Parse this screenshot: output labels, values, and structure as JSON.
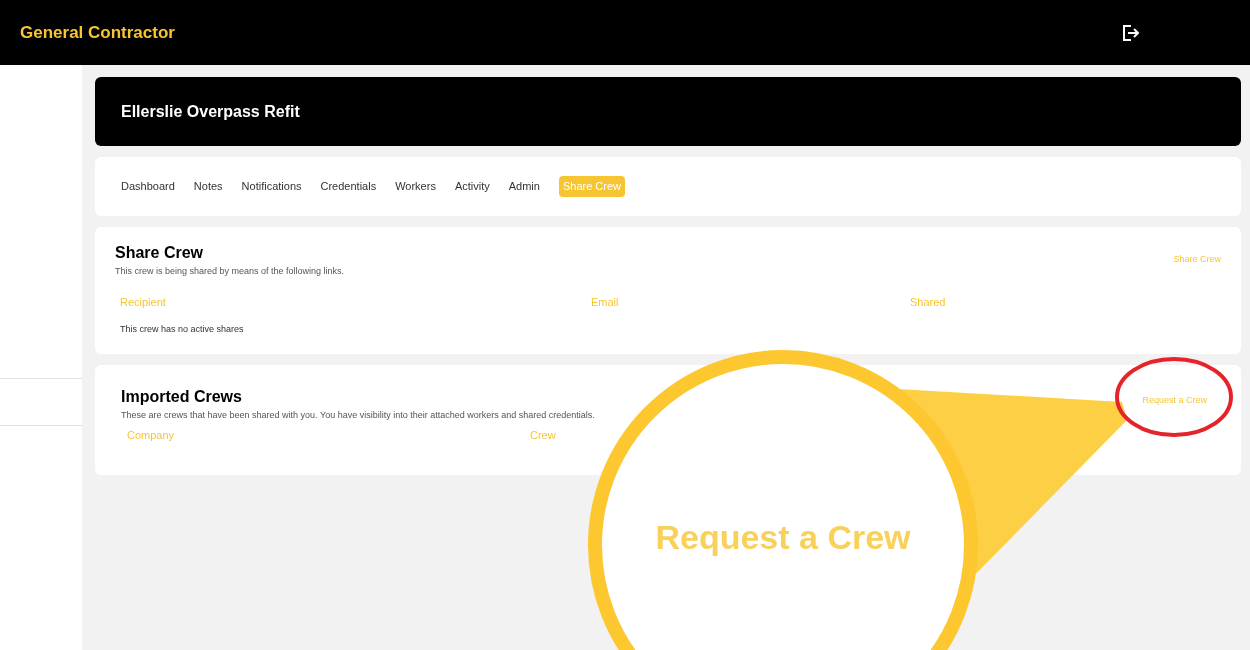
{
  "header": {
    "title": "General Contractor"
  },
  "project": {
    "title": "Ellerslie Overpass Refit"
  },
  "tabs": [
    {
      "label": "Dashboard",
      "selected": false
    },
    {
      "label": "Notes",
      "selected": false
    },
    {
      "label": "Notifications",
      "selected": false
    },
    {
      "label": "Credentials",
      "selected": false
    },
    {
      "label": "Workers",
      "selected": false
    },
    {
      "label": "Activity",
      "selected": false
    },
    {
      "label": "Admin",
      "selected": false
    },
    {
      "label": "Share Crew",
      "selected": true
    }
  ],
  "share_crew": {
    "title": "Share Crew",
    "description": "This crew is being shared by means of the following links.",
    "action": "Share Crew",
    "columns": [
      "Recipient",
      "Email",
      "Shared"
    ],
    "empty": "This crew has no active shares"
  },
  "imported_crews": {
    "title": "Imported Crews",
    "description": "These are crews that have been shared with you. You have visibility into their attached workers and shared credentials.",
    "action": "Request a Crew",
    "columns": [
      "Company",
      "Crew"
    ]
  },
  "callout": {
    "text": "Request a Crew"
  }
}
